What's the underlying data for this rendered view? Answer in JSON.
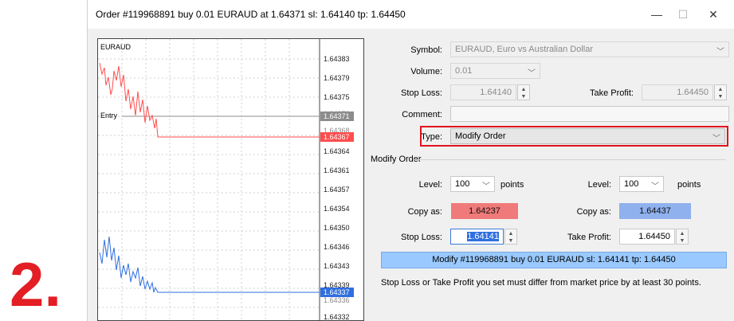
{
  "step_number": "2.",
  "window": {
    "title": "Order #119968891 buy 0.01 EURAUD at 1.64371 sl: 1.64140 tp: 1.64450",
    "minimize": "—",
    "maximize": "☐",
    "close": "✕"
  },
  "chart": {
    "symbol_label": "EURAUD",
    "entry_label": "Entry",
    "price_axis": [
      "1.64383",
      "1.64379",
      "1.64375",
      "1.64372",
      "1.64371",
      "1.64368",
      "1.64367",
      "1.64364",
      "1.64361",
      "1.64357",
      "1.64354",
      "1.64350",
      "1.64346",
      "1.64343",
      "1.64339",
      "1.64337",
      "1.64336",
      "1.64332"
    ],
    "entry_price_tag": "1.64371",
    "ask_price_tag": "1.64367",
    "bid_price_tag": "1.64337",
    "colors": {
      "ask_line": "#ff4d4d",
      "bid_line": "#2f6fe0",
      "entry_line": "#8c8c8c"
    }
  },
  "form": {
    "symbol": {
      "label": "Symbol:",
      "value": "EURAUD, Euro vs Australian Dollar"
    },
    "volume": {
      "label": "Volume:",
      "value": "0.01"
    },
    "stop_loss": {
      "label": "Stop Loss:",
      "value": "1.64140"
    },
    "take_profit": {
      "label": "Take Profit:",
      "value": "1.64450"
    },
    "comment": {
      "label": "Comment:",
      "value": ""
    },
    "type": {
      "label": "Type:",
      "value": "Modify Order"
    }
  },
  "modify_order": {
    "group_title": "Modify Order",
    "level_label": "Level:",
    "points_label": "points",
    "left_level": "100",
    "right_level": "100",
    "copy_as_label": "Copy as:",
    "copy_left_value": "1.64237",
    "copy_right_value": "1.64437",
    "stop_loss_label": "Stop Loss:",
    "stop_loss_value": "1.64141",
    "take_profit_label": "Take Profit:",
    "take_profit_value": "1.64450",
    "modify_button": "Modify #119968891 buy 0.01 EURAUD sl: 1.64141 tp: 1.64450",
    "note": "Stop Loss or Take Profit you set must differ from market price by at least 30 points."
  },
  "colors": {
    "copy_left_bg": "#f07a7a",
    "copy_right_bg": "#8fb1ee",
    "modify_button_bg": "#99c9ff",
    "highlight": "#e0131e",
    "step_badge": "#e31e24"
  }
}
